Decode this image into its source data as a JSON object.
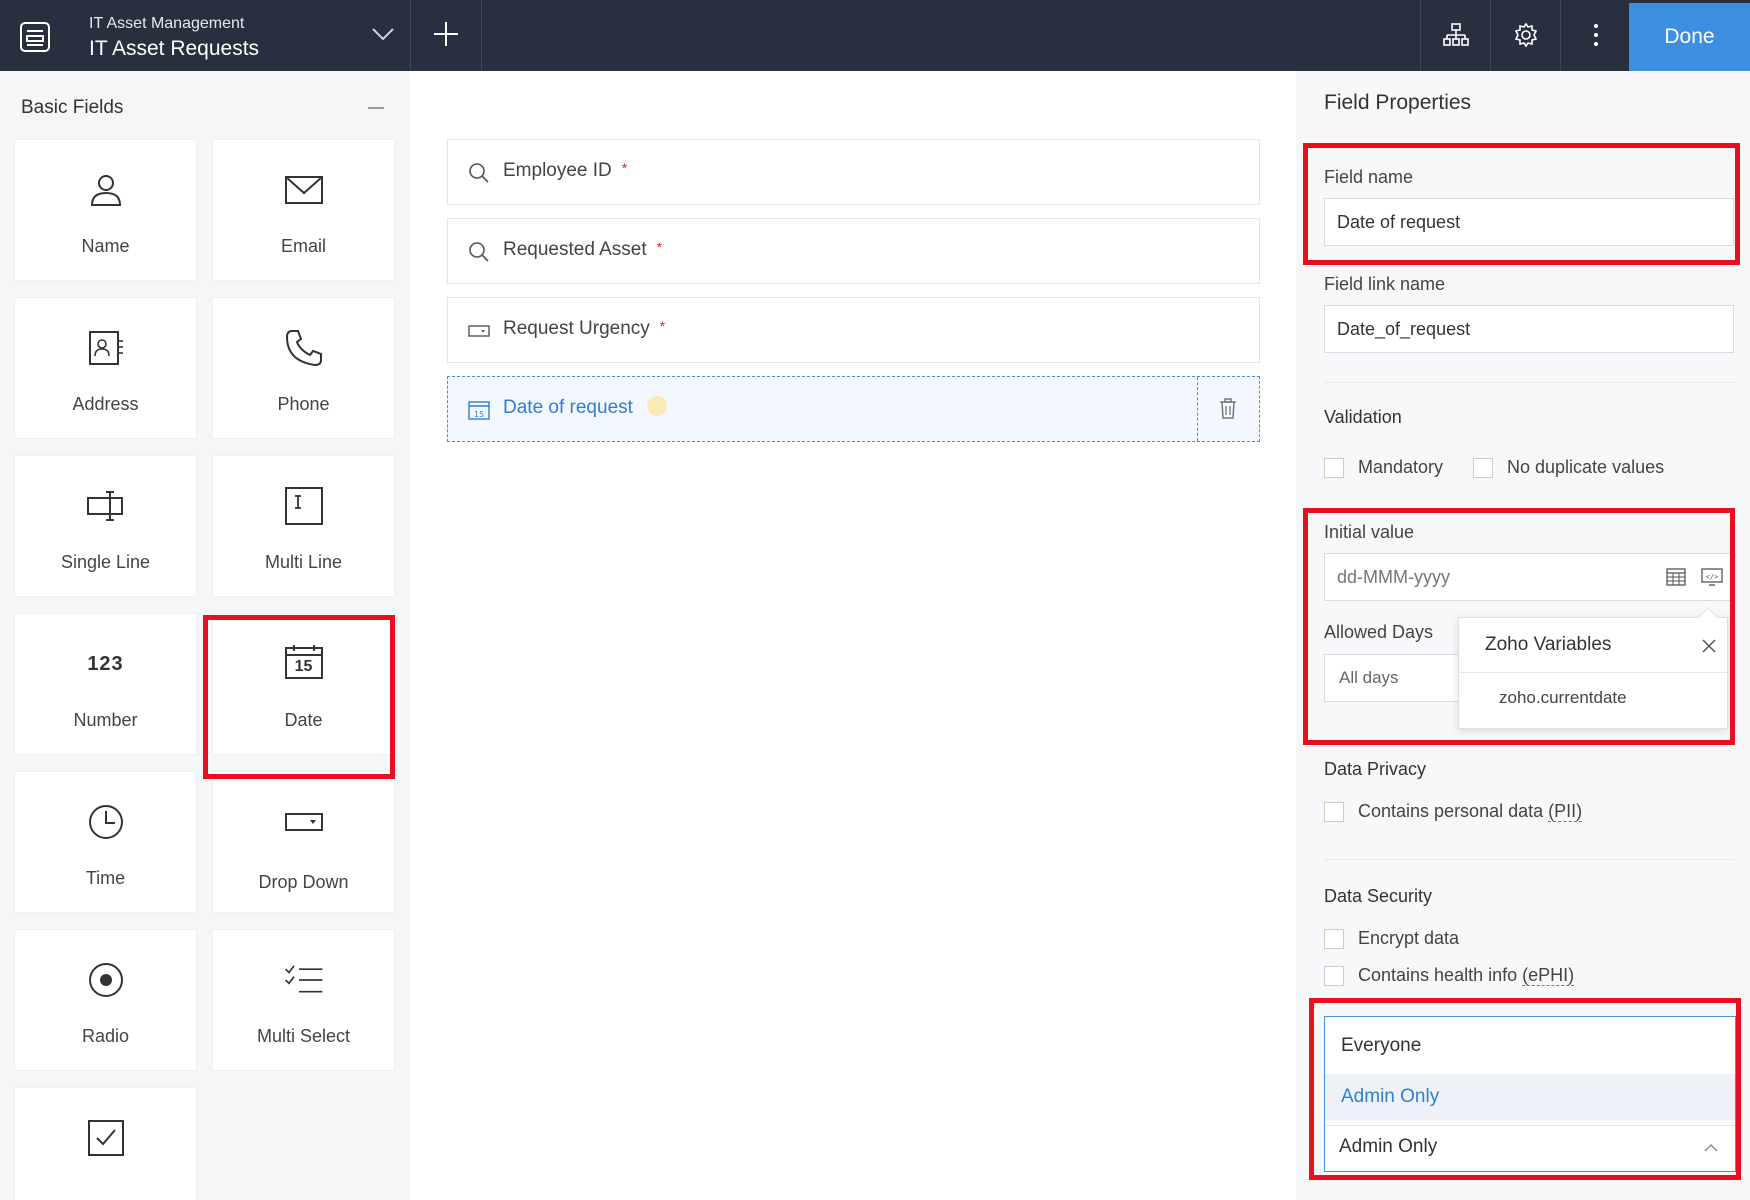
{
  "header": {
    "app_subtitle": "IT Asset Management",
    "app_title": "IT Asset Requests",
    "done_label": "Done",
    "icons": [
      "form-icon",
      "chevron-down-icon",
      "plus-icon",
      "sitemap-icon",
      "gear-icon",
      "more-vertical-icon"
    ]
  },
  "left_panel": {
    "title": "Basic Fields",
    "tiles": [
      {
        "label": "Name",
        "icon": "person-icon"
      },
      {
        "label": "Email",
        "icon": "envelope-icon"
      },
      {
        "label": "Address",
        "icon": "address-card-icon"
      },
      {
        "label": "Phone",
        "icon": "phone-icon"
      },
      {
        "label": "Single Line",
        "icon": "single-line-icon"
      },
      {
        "label": "Multi Line",
        "icon": "multi-line-icon"
      },
      {
        "label": "Number",
        "icon": "number-icon",
        "glyph": "123"
      },
      {
        "label": "Date",
        "icon": "calendar-icon",
        "glyph": "15"
      },
      {
        "label": "Time",
        "icon": "clock-icon"
      },
      {
        "label": "Drop Down",
        "icon": "dropdown-icon"
      },
      {
        "label": "Radio",
        "icon": "radio-icon"
      },
      {
        "label": "Multi Select",
        "icon": "checklist-icon"
      },
      {
        "label": "",
        "icon": "checkbox-icon"
      }
    ]
  },
  "canvas": {
    "fields": [
      {
        "label": "Employee ID",
        "required_mark": "*",
        "icon": "search-icon"
      },
      {
        "label": "Requested Asset",
        "required_mark": "*",
        "icon": "search-icon"
      },
      {
        "label": "Request Urgency",
        "required_mark": "*",
        "icon": "dropdown-icon"
      },
      {
        "label": "Date of request",
        "icon": "calendar-icon",
        "selected": true
      }
    ]
  },
  "field_properties": {
    "title": "Field Properties",
    "field_name_label": "Field name",
    "field_name_value": "Date of request",
    "field_link_name_label": "Field link name",
    "field_link_name_value": "Date_of_request",
    "validation_title": "Validation",
    "mandatory_label": "Mandatory",
    "no_duplicate_label": "No duplicate values",
    "initial_value_label": "Initial value",
    "initial_value_placeholder": "dd-MMM-yyyy",
    "allowed_days_label": "Allowed Days",
    "allowed_days_value": "All days",
    "zoho_variables": {
      "title": "Zoho Variables",
      "item": "zoho.currentdate"
    },
    "data_privacy_title": "Data Privacy",
    "pii_label": "Contains personal data",
    "pii_abbr": "(PII)",
    "data_security_title": "Data Security",
    "encrypt_label": "Encrypt data",
    "ephi_label": "Contains health info",
    "ephi_abbr": "(ePHI)",
    "access_dropdown": {
      "options": [
        "Everyone",
        "Admin Only"
      ],
      "highlighted": "Admin Only",
      "current": "Admin Only"
    }
  },
  "colors": {
    "topbar": "#282f3f",
    "accent": "#3d8fe0",
    "highlight_red": "#e8101e",
    "required": "#e02020"
  }
}
